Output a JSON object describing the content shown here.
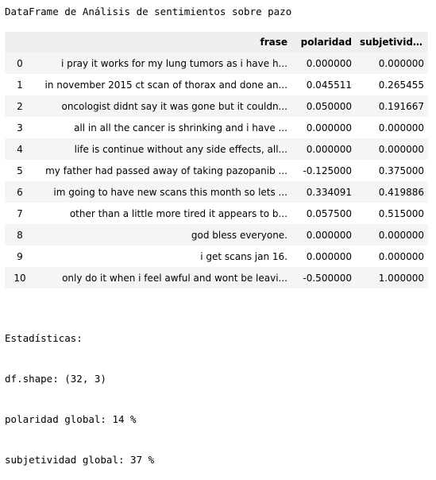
{
  "title": "DataFrame de Análisis de sentimientos sobre pazo",
  "table": {
    "columns": [
      "frase",
      "polaridad",
      "subjetividad"
    ],
    "rows": [
      {
        "index": "0",
        "frase": "i pray it works for my lung tumors as i have h...",
        "polaridad": "0.000000",
        "subjetividad": "0.000000"
      },
      {
        "index": "1",
        "frase": "in november 2015 ct scan of thorax and done an...",
        "polaridad": "0.045511",
        "subjetividad": "0.265455"
      },
      {
        "index": "2",
        "frase": "oncologist didnt say it was gone but it couldn...",
        "polaridad": "0.050000",
        "subjetividad": "0.191667"
      },
      {
        "index": "3",
        "frase": "all in all the cancer is shrinking and i have ...",
        "polaridad": "0.000000",
        "subjetividad": "0.000000"
      },
      {
        "index": "4",
        "frase": "life is continue without any side effects, all...",
        "polaridad": "0.000000",
        "subjetividad": "0.000000"
      },
      {
        "index": "5",
        "frase": "my father had passed away of taking pazopanib ...",
        "polaridad": "-0.125000",
        "subjetividad": "0.375000"
      },
      {
        "index": "6",
        "frase": "im going to have new scans this month so lets ...",
        "polaridad": "0.334091",
        "subjetividad": "0.419886"
      },
      {
        "index": "7",
        "frase": "other than a little more tired it appears to b...",
        "polaridad": "0.057500",
        "subjetividad": "0.515000"
      },
      {
        "index": "8",
        "frase": "god bless everyone.",
        "polaridad": "0.000000",
        "subjetividad": "0.000000"
      },
      {
        "index": "9",
        "frase": "i get scans jan 16.",
        "polaridad": "0.000000",
        "subjetividad": "0.000000"
      },
      {
        "index": "10",
        "frase": "only do it when i feel awful and wont be leavi...",
        "polaridad": "-0.500000",
        "subjetividad": "1.000000"
      }
    ]
  },
  "stats": {
    "heading": "Estadísticas:",
    "shape": "df.shape: (32, 3)",
    "polaridad": "polaridad global: 14 %",
    "subjetividad": "subjetividad global: 37 %"
  }
}
